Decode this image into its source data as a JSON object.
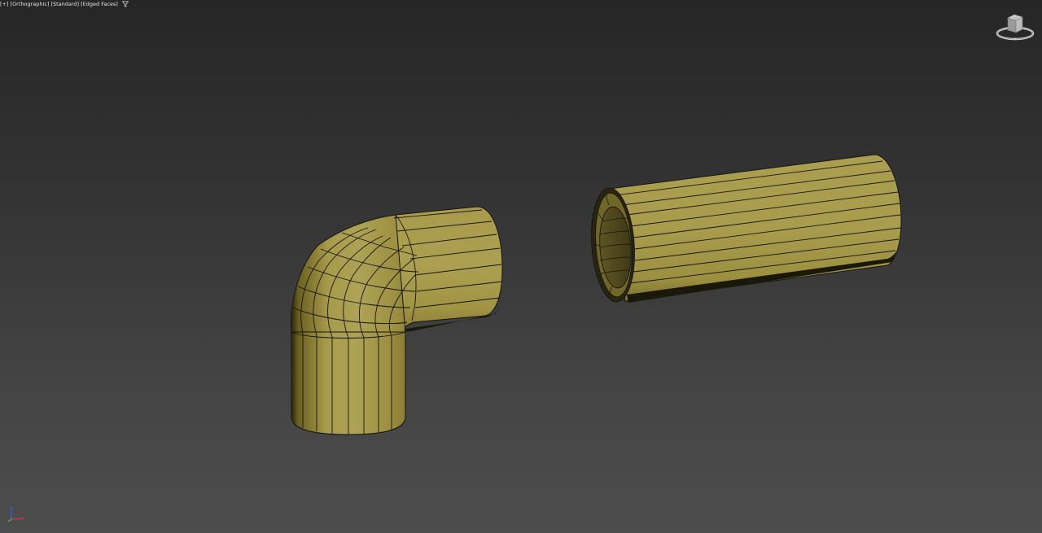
{
  "viewport": {
    "labels": [
      "[+]",
      "[Orthographic]",
      "[Standard]",
      "[Edged Faces]"
    ],
    "filter_icon": "filter-icon"
  },
  "viewcube": {
    "face_label": "TOP",
    "icon": "viewcube-icon"
  },
  "axis_tripod": {
    "icon": "axis-tripod-icon",
    "colors": {
      "x": "#d83a3a",
      "y": "#3ac83a",
      "z": "#3a5ad8"
    }
  },
  "scene": {
    "objects": [
      "elbow-pipe-object",
      "straight-pipe-object"
    ],
    "material_color": "#a89a4a",
    "edge_color": "#141414"
  }
}
